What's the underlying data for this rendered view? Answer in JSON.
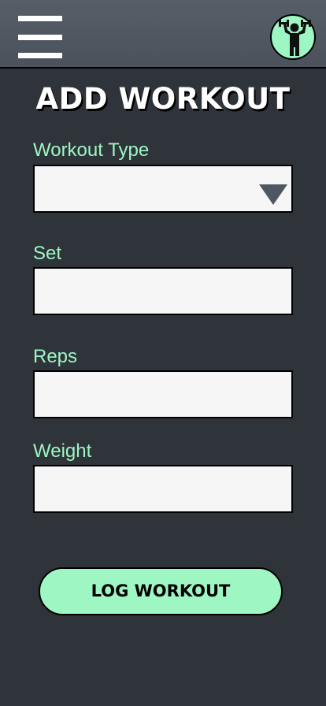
{
  "colors": {
    "background": "#2f333a",
    "header": "#4f5761",
    "accent": "#9ef7c3",
    "input_background": "#f6f6f6"
  },
  "header": {
    "menu_icon": "hamburger-menu-icon",
    "avatar_icon": "weightlifter-icon"
  },
  "main": {
    "title": "ADD WORKOUT",
    "fields": [
      {
        "label": "Workout Type",
        "value": "",
        "control": "select",
        "icon": "dropdown-arrow-icon"
      },
      {
        "label": "Set",
        "value": "",
        "control": "text"
      },
      {
        "label": "Reps",
        "value": "",
        "control": "text"
      },
      {
        "label": "Weight",
        "value": "",
        "control": "text"
      }
    ],
    "submit_label": "LOG WORKOUT"
  }
}
